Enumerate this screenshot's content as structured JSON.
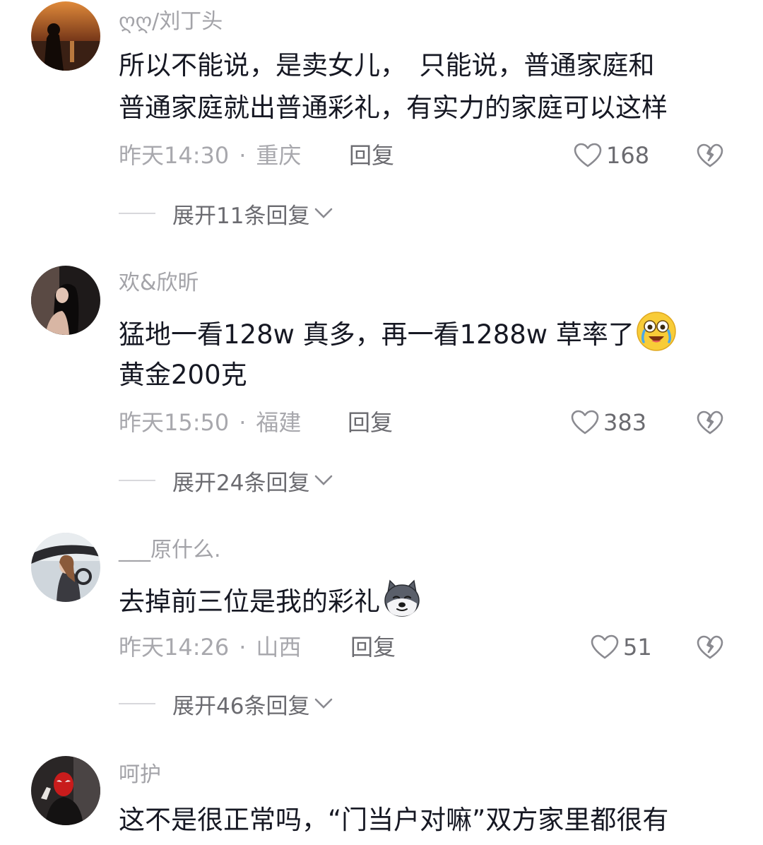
{
  "header_partial": "",
  "comments": [
    {
      "username": "ღღ/刘丁头",
      "lines": [
        "所以不能说，是卖女儿，　只能说，普通家庭和",
        "普通家庭就出普通彩礼，有实力的家庭可以这样"
      ],
      "time": "昨天14:30",
      "location": "重庆",
      "reply": "回复",
      "likes": "168",
      "expand": "展开11条回复"
    },
    {
      "username": "欢&欣昕",
      "lines": [
        "猛地一看128w  真多，再一看1288w 草率了",
        "黄金200克"
      ],
      "emoji": "crying-laughing-emoji",
      "time": "昨天15:50",
      "location": "福建",
      "reply": "回复",
      "likes": "383",
      "expand": "展开24条回复"
    },
    {
      "username": "___原什么.",
      "lines": [
        "去掉前三位是我的彩礼"
      ],
      "emoji": "husky-dog-emoji",
      "time": "昨天14:26",
      "location": "山西",
      "reply": "回复",
      "likes": "51",
      "expand": "展开46条回复"
    },
    {
      "username": "呵护",
      "lines": [
        "这不是很正常吗，“门当户对嘛”双方家里都很有"
      ]
    }
  ],
  "colors": {
    "text": "#161823",
    "muted": "#a8a8ad",
    "action": "#6b6b70"
  }
}
